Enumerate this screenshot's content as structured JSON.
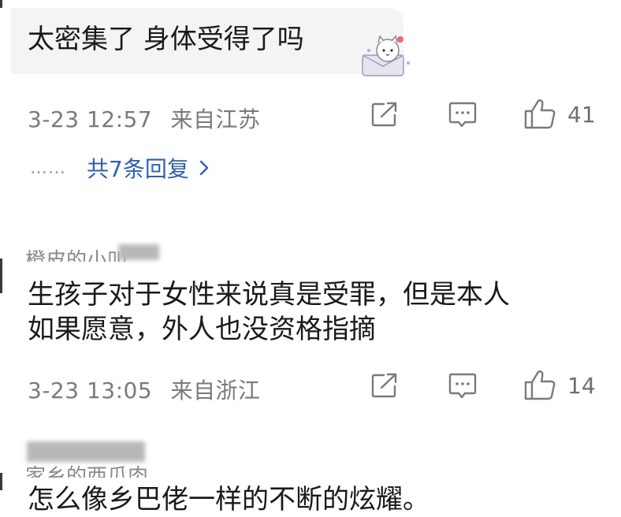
{
  "comments": [
    {
      "text": "太密集了 身体受得了吗",
      "time": "3-23 12:57",
      "location": "来自江苏",
      "likes": "41",
      "replies_label": "共7条回复",
      "replies_dots": "……"
    },
    {
      "username": "橙皮的小叫",
      "text": "生孩子对于女性来说真是受罪，但是本人\n如果愿意，外人也没资格指摘",
      "time": "3-23 13:05",
      "location": "来自浙江",
      "likes": "14"
    },
    {
      "username": "家乡的西瓜肉",
      "text": "怎么像乡巴佬一样的不断的炫耀。"
    }
  ],
  "icons": {
    "share": "share-icon",
    "reply": "comment-icon",
    "like": "thumbs-up-icon",
    "chevron": "chevron-right-icon",
    "sticker": "cat-sticker-icon"
  },
  "colors": {
    "link": "#2f5fb0",
    "meta": "#7a7a7a",
    "bubble": "#f6f3f5"
  }
}
